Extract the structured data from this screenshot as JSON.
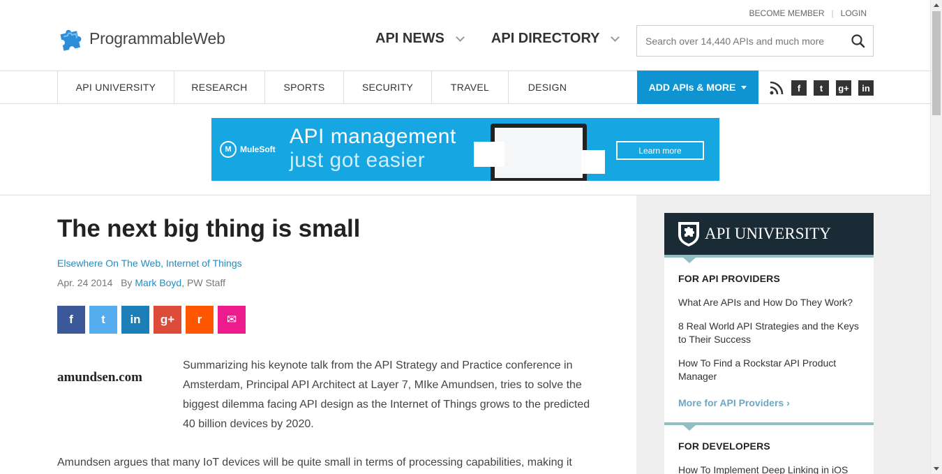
{
  "header": {
    "logo_text": "ProgrammableWeb",
    "become_member": "BECOME MEMBER",
    "separator": "|",
    "login": "LOGIN",
    "nav": [
      {
        "label": "API NEWS"
      },
      {
        "label": "API DIRECTORY"
      }
    ],
    "search_placeholder": "Search over 14,440 APIs and much more"
  },
  "categories": [
    "API UNIVERSITY",
    "RESEARCH",
    "SPORTS",
    "SECURITY",
    "TRAVEL",
    "DESIGN"
  ],
  "add_apis_label": "ADD APIs & MORE",
  "social_top": {
    "facebook": "f",
    "twitter": "t",
    "googleplus": "g+",
    "linkedin": "in"
  },
  "banner": {
    "brand": "MuleSoft",
    "headline1": "API management",
    "headline2": "just got easier",
    "cta": "Learn more"
  },
  "article": {
    "title": "The next big thing is small",
    "category1": "Elsewhere On The Web",
    "category_sep": ", ",
    "category2": "Internet of Things",
    "date": "Apr. 24 2014",
    "by": "By",
    "author": "Mark Boyd",
    "author_suffix": ", PW Staff",
    "thumb_text": "amundsen.com",
    "intro": "Summarizing his keynote talk from the API Strategy and Practice conference in Amsterdam, Principal API Architect at Layer 7, MIke Amundsen, tries to solve the biggest dilemma facing API design as the Internet of Things grows to the predicted 40 billion devices by 2020.",
    "para2": "Amundsen argues that many IoT devices will be quite small in terms of processing capabilities, making it"
  },
  "share_buttons": [
    {
      "name": "facebook",
      "glyph": "f",
      "color": "#3b5998"
    },
    {
      "name": "twitter",
      "glyph": "t",
      "color": "#55acee"
    },
    {
      "name": "linkedin",
      "glyph": "in",
      "color": "#1d7fb8"
    },
    {
      "name": "googleplus",
      "glyph": "g+",
      "color": "#dd4b39"
    },
    {
      "name": "reddit",
      "glyph": "r",
      "color": "#ff5700"
    },
    {
      "name": "email",
      "glyph": "✉",
      "color": "#ec1c8c"
    }
  ],
  "sidebar": {
    "title": "API UNIVERSITY",
    "providers": {
      "heading": "FOR API PROVIDERS",
      "links": [
        "What Are APIs and How Do They Work?",
        "8 Real World API Strategies and the Keys to Their Success",
        "How To Find a Rockstar API Product Manager"
      ],
      "more": "More for API Providers  ›"
    },
    "developers": {
      "heading": "FOR DEVELOPERS",
      "links": [
        "How To Implement Deep Linking in iOS"
      ]
    }
  },
  "colors": {
    "brand_blue": "#0f94d1",
    "link_blue": "#1a8ec7",
    "sidebar_dark": "#1b2b35",
    "sidebar_accent": "#8fbfc4"
  }
}
